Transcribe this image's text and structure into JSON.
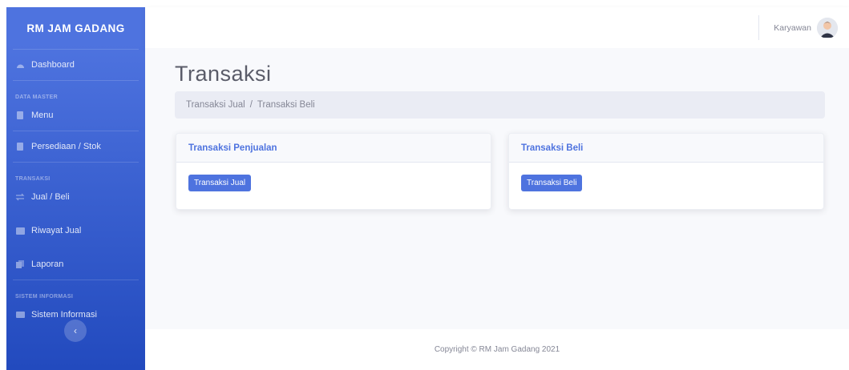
{
  "sidebar": {
    "brand": "RM JAM GADANG",
    "dashboard": "Dashboard",
    "heading_master": "DATA MASTER",
    "menu": "Menu",
    "stok": "Persediaan / Stok",
    "heading_transaksi": "TRANSAKSI",
    "jual_beli": "Jual / Beli",
    "riwayat": "Riwayat Jual",
    "laporan": "Laporan",
    "heading_sistem": "SISTEM INFORMASI",
    "sistem": "Sistem Informasi",
    "toggle_glyph": "‹"
  },
  "topbar": {
    "user_name": "Karyawan"
  },
  "main": {
    "title": "Transaksi",
    "breadcrumb": {
      "first": "Transaksi Jual",
      "separator": "/",
      "second": "Transaksi Beli"
    },
    "cards": [
      {
        "header": "Transaksi Penjualan",
        "button": "Transaksi Jual"
      },
      {
        "header": "Transaksi Beli",
        "button": "Transaksi Beli"
      }
    ]
  },
  "footer": {
    "copyright": "Copyright © RM Jam Gadang 2021"
  },
  "colors": {
    "primary": "#4e73df",
    "primary_dark": "#224abe",
    "bg": "#f8f9fc"
  }
}
